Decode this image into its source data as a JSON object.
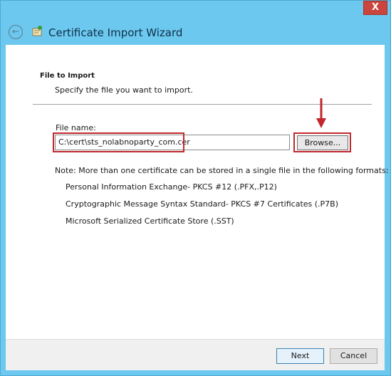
{
  "window": {
    "title": "Certificate Import Wizard",
    "close_label": "X"
  },
  "section": {
    "title": "File to Import",
    "subtitle": "Specify the file you want to import."
  },
  "file_field": {
    "label": "File name:",
    "value": "C:\\cert\\sts_nolabnoparty_com.cer"
  },
  "browse_label": "Browse...",
  "note": "Note:  More than one certificate can be stored in a single file in the following formats:",
  "formats": [
    "Personal Information Exchange- PKCS #12 (.PFX,.P12)",
    "Cryptographic Message Syntax Standard- PKCS #7 Certificates (.P7B)",
    "Microsoft Serialized Certificate Store (.SST)"
  ],
  "footer": {
    "next_label": "Next",
    "cancel_label": "Cancel"
  },
  "colors": {
    "titlebar": "#6cc8ee",
    "highlight": "#c1272d",
    "close_button": "#c9453d"
  },
  "icons": [
    "back-arrow-icon",
    "certificate-wizard-icon",
    "close-icon",
    "red-down-arrow-icon"
  ]
}
